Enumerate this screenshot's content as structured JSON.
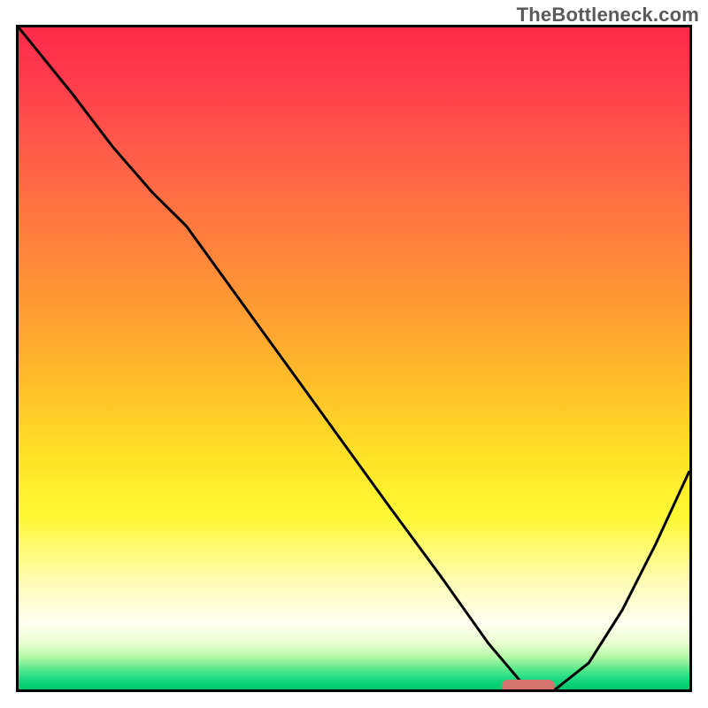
{
  "watermark": "TheBottleneck.com",
  "colors": {
    "border": "#000000",
    "line": "#000000",
    "marker": "#d6756d",
    "gradient_stops": [
      "#ff2a4a",
      "#ff7a3f",
      "#ffe627",
      "#fffdb8",
      "#57e88c",
      "#00c76e"
    ]
  },
  "chart_data": {
    "type": "line",
    "title": "",
    "xlabel": "",
    "ylabel": "",
    "xlim": [
      0,
      1
    ],
    "ylim": [
      0,
      1
    ],
    "grid": false,
    "legend": false,
    "annotations": [],
    "series": [
      {
        "name": "bottleneck-curve",
        "x": [
          0.0,
          0.08,
          0.14,
          0.2,
          0.25,
          0.35,
          0.45,
          0.55,
          0.63,
          0.7,
          0.75,
          0.79,
          0.8,
          0.85,
          0.9,
          0.95,
          1.0
        ],
        "y": [
          1.0,
          0.9,
          0.82,
          0.75,
          0.7,
          0.56,
          0.42,
          0.28,
          0.17,
          0.07,
          0.01,
          0.0,
          0.0,
          0.04,
          0.12,
          0.22,
          0.33
        ]
      }
    ],
    "marker": {
      "name": "optimal-range",
      "x_start": 0.72,
      "x_end": 0.8,
      "y": 0.005
    },
    "background": "vertical-rainbow-gradient"
  }
}
